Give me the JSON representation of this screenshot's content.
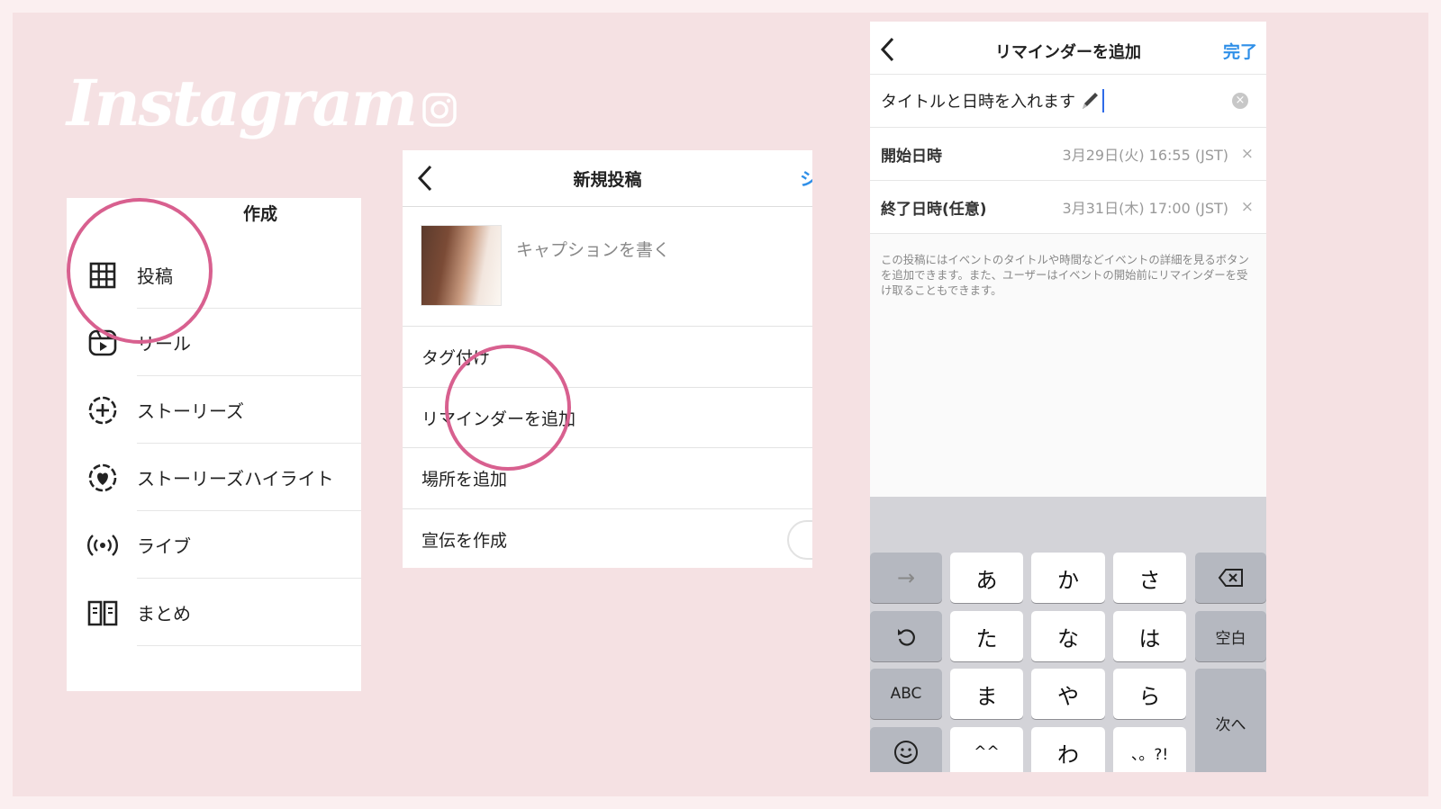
{
  "logo": {
    "text": "Instagram",
    "icon": "camera-icon"
  },
  "create_menu": {
    "title": "作成",
    "items": [
      {
        "label": "投稿",
        "icon": "grid-icon"
      },
      {
        "label": "リール",
        "icon": "reel-icon"
      },
      {
        "label": "ストーリーズ",
        "icon": "story-add-icon"
      },
      {
        "label": "ストーリーズハイライト",
        "icon": "highlight-heart-icon"
      },
      {
        "label": "ライブ",
        "icon": "live-icon"
      },
      {
        "label": "まとめ",
        "icon": "guide-book-icon"
      }
    ]
  },
  "new_post": {
    "title": "新規投稿",
    "share_label": "シ",
    "caption_placeholder": "キャプションを書く",
    "rows": [
      "タグ付け",
      "リマインダーを追加",
      "場所を追加",
      "宣伝を作成"
    ]
  },
  "reminder": {
    "title": "リマインダーを追加",
    "done_label": "完了",
    "title_input_value": "タイトルと日時を入れます",
    "start_label": "開始日時",
    "start_value": "3月29日(火) 16:55 (JST)",
    "end_label": "終了日時(任意)",
    "end_value": "3月31日(木) 17:00 (JST)",
    "clear_glyph": "×",
    "note": "この投稿にはイベントのタイトルや時間などイベントの詳細を見るボタンを追加できます。また、ユーザーはイベントの開始前にリマインダーを受け取ることもできます。"
  },
  "keyboard": {
    "arrow": "→",
    "row1": [
      "あ",
      "か",
      "さ"
    ],
    "row2": [
      "た",
      "な",
      "は"
    ],
    "row3": [
      "ま",
      "や",
      "ら"
    ],
    "row4": [
      "^^",
      "わ",
      "、。?!"
    ],
    "space": "空白",
    "abc": "ABC",
    "next": "次へ"
  },
  "colors": {
    "accent_blue": "#2f8fe8",
    "highlight_ring": "#d8608f",
    "background": "#f5e1e3"
  }
}
